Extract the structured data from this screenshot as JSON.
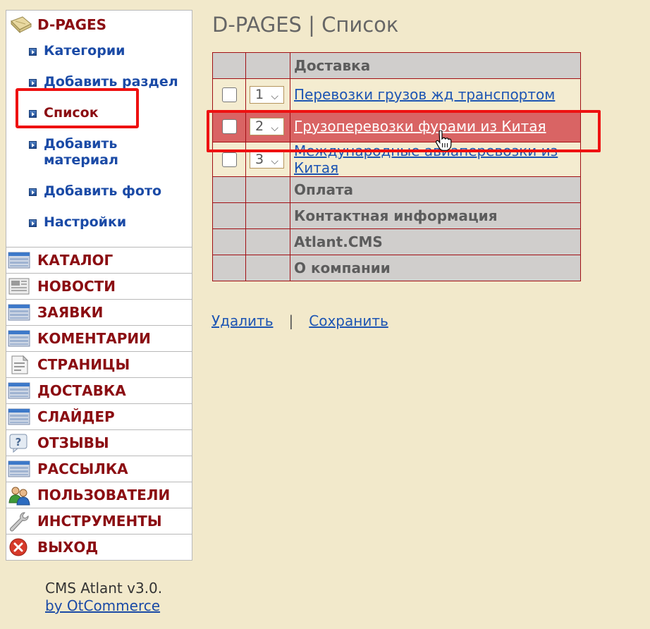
{
  "sidebar": {
    "module_title": "D-PAGES",
    "submenu": [
      {
        "label": "Категории"
      },
      {
        "label": "Добавить раздел"
      },
      {
        "label": "Список"
      },
      {
        "label": "Добавить материал"
      },
      {
        "label": "Добавить фото"
      },
      {
        "label": "Настройки"
      }
    ],
    "menu": [
      {
        "label": "КАТАЛОГ",
        "icon": "list-grid-icon"
      },
      {
        "label": "НОВОСТИ",
        "icon": "newspaper-icon"
      },
      {
        "label": "ЗАЯВКИ",
        "icon": "list-grid-icon"
      },
      {
        "label": "КОМЕНТАРИИ",
        "icon": "list-grid-icon"
      },
      {
        "label": "СТРАНИЦЫ",
        "icon": "document-icon"
      },
      {
        "label": "ДОСТАВКА",
        "icon": "list-grid-icon"
      },
      {
        "label": "СЛАЙДЕР",
        "icon": "list-grid-icon"
      },
      {
        "label": "ОТЗЫВЫ",
        "icon": "help-question-icon"
      },
      {
        "label": "РАССЫЛКА",
        "icon": "list-grid-icon"
      },
      {
        "label": "ПОЛЬЗОВАТЕЛИ",
        "icon": "users-icon"
      },
      {
        "label": "ИНСТРУМЕНТЫ",
        "icon": "wrench-icon"
      },
      {
        "label": "ВЫХОД",
        "icon": "exit-x-icon"
      }
    ]
  },
  "footer": {
    "line1": "CMS Atlant v3.0.",
    "link": "by OtCommerce"
  },
  "main": {
    "title": "D-PAGES | Список",
    "sections": [
      {
        "title": "Доставка"
      },
      {
        "title": "Оплата"
      },
      {
        "title": "Контактная информация"
      },
      {
        "title": "Atlant.CMS"
      },
      {
        "title": "О компании"
      }
    ],
    "items": [
      {
        "order": "1",
        "title": "Перевозки грузов жд транспортом"
      },
      {
        "order": "2",
        "title": "Грузоперевозки фурами из Китая"
      },
      {
        "order": "3",
        "title": "Международные авиаперевозки из Китая"
      }
    ],
    "actions": {
      "delete": "Удалить",
      "separator": "|",
      "save": "Сохранить"
    }
  },
  "colors": {
    "background": "#f2e9cb",
    "menu_text": "#8b0d12",
    "link": "#1a4aa6",
    "selected_row": "#d96464",
    "highlight": "#ee1111"
  }
}
